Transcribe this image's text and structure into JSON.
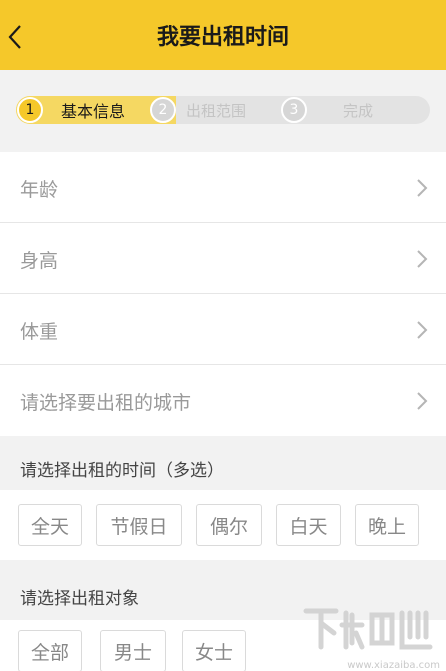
{
  "header": {
    "title": "我要出租时间",
    "back_icon": "chevron-left-icon"
  },
  "steps": [
    {
      "num": "1",
      "label": "基本信息",
      "state": "active"
    },
    {
      "num": "2",
      "label": "出租范围",
      "state": "inactive"
    },
    {
      "num": "3",
      "label": "完成",
      "state": "inactive"
    }
  ],
  "form_rows": [
    {
      "label": "年龄"
    },
    {
      "label": "身高"
    },
    {
      "label": "体重"
    },
    {
      "label": "请选择要出租的城市"
    }
  ],
  "time_section": {
    "title": "请选择出租的时间（多选）",
    "options": [
      "全天",
      "节假日",
      "偶尔",
      "白天",
      "晚上"
    ]
  },
  "target_section": {
    "title": "请选择出租对象",
    "options": [
      "全部",
      "男士",
      "女士"
    ]
  },
  "watermark": {
    "text": "www.xiazaiba.com"
  },
  "colors": {
    "accent": "#f5c82a",
    "step_fill": "#f5d862",
    "background": "#f2f2f2"
  }
}
